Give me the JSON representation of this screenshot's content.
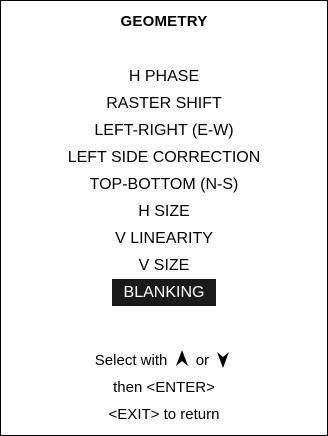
{
  "menu": {
    "title": "GEOMETRY",
    "items": [
      {
        "label": "H PHASE"
      },
      {
        "label": "RASTER SHIFT"
      },
      {
        "label": "LEFT-RIGHT (E-W)"
      },
      {
        "label": "LEFT SIDE CORRECTION"
      },
      {
        "label": "TOP-BOTTOM (N-S)"
      },
      {
        "label": "H SIZE"
      },
      {
        "label": "V LINEARITY"
      },
      {
        "label": "V SIZE"
      },
      {
        "label": "BLANKING",
        "selected": true
      }
    ]
  },
  "instructions": {
    "select_prefix": "Select with",
    "or_text": "or",
    "up_icon": "arrow-up-icon",
    "down_icon": "arrow-down-icon",
    "enter_line": "then <ENTER>",
    "exit_line": "<EXIT> to return"
  },
  "colors": {
    "selection_background": "#1a1a1a",
    "selection_text": "#ffffff",
    "text": "#000000",
    "background": "#ffffff"
  }
}
